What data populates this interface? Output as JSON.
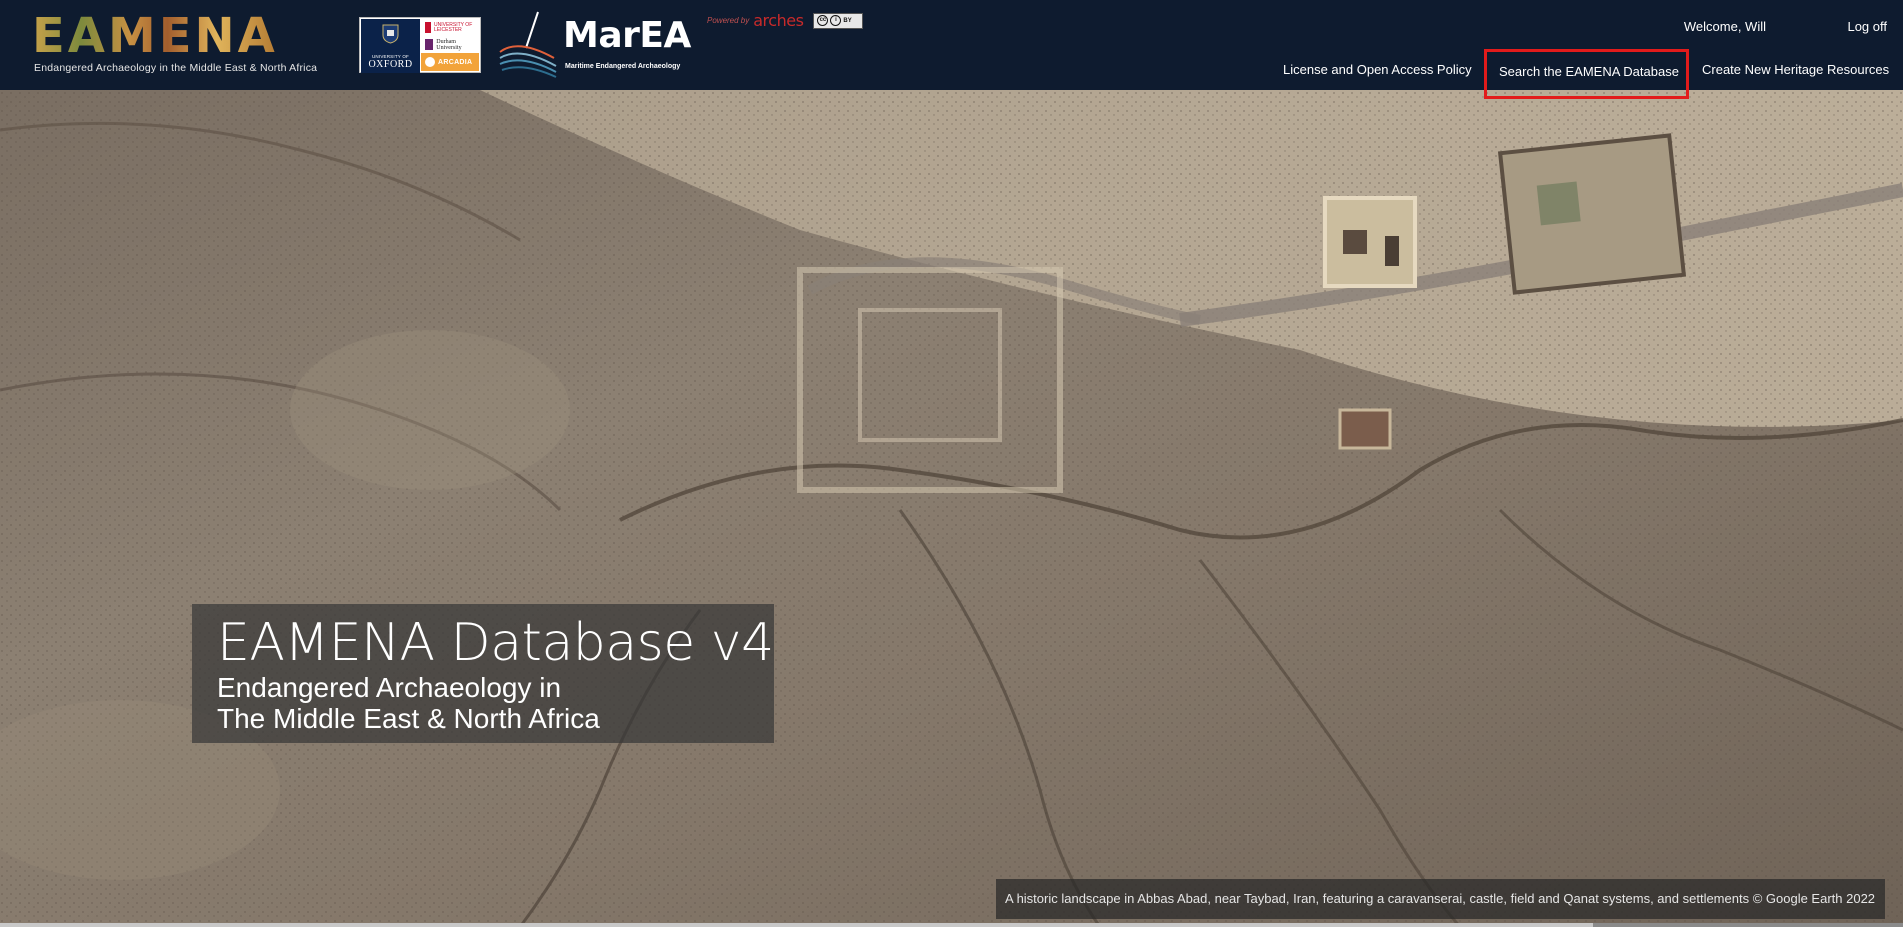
{
  "brand": {
    "eamena_logo_text": "EAMENA",
    "eamena_tagline": "Endangered Archaeology in the Middle East & North Africa",
    "oxford_small": "UNIVERSITY OF",
    "oxford_big": "OXFORD",
    "leicester": "UNIVERSITY OF LEICESTER",
    "durham": "Durham University",
    "arcadia": "ARCADIA",
    "marea_logo_text": "MarEA",
    "marea_tagline": "Maritime Endangered Archaeology",
    "powered_by": "Powered by",
    "arches": "arches",
    "cc_label": "BY"
  },
  "user": {
    "welcome": "Welcome, Will",
    "logoff": "Log off"
  },
  "nav": {
    "license": "License and Open Access Policy",
    "search": "Search the EAMENA Database",
    "create": "Create New Heritage Resources"
  },
  "hero": {
    "title": "EAMENA Database v4",
    "subtitle_line1": "Endangered Archaeology in",
    "subtitle_line2": "The Middle East & North Africa",
    "caption": "A historic landscape in Abbas Abad, near Taybad, Iran, featuring a caravanserai, castle, field and Qanat systems, and settlements © Google Earth 2022"
  },
  "colors": {
    "header_bg": "#0e1b2f",
    "highlight_border": "#e21b1b",
    "terrain": "#8c7f70"
  },
  "icons": {
    "cc": "creative-commons-icon",
    "oxford": "oxford-crest-icon",
    "marea": "marea-wave-icon"
  }
}
